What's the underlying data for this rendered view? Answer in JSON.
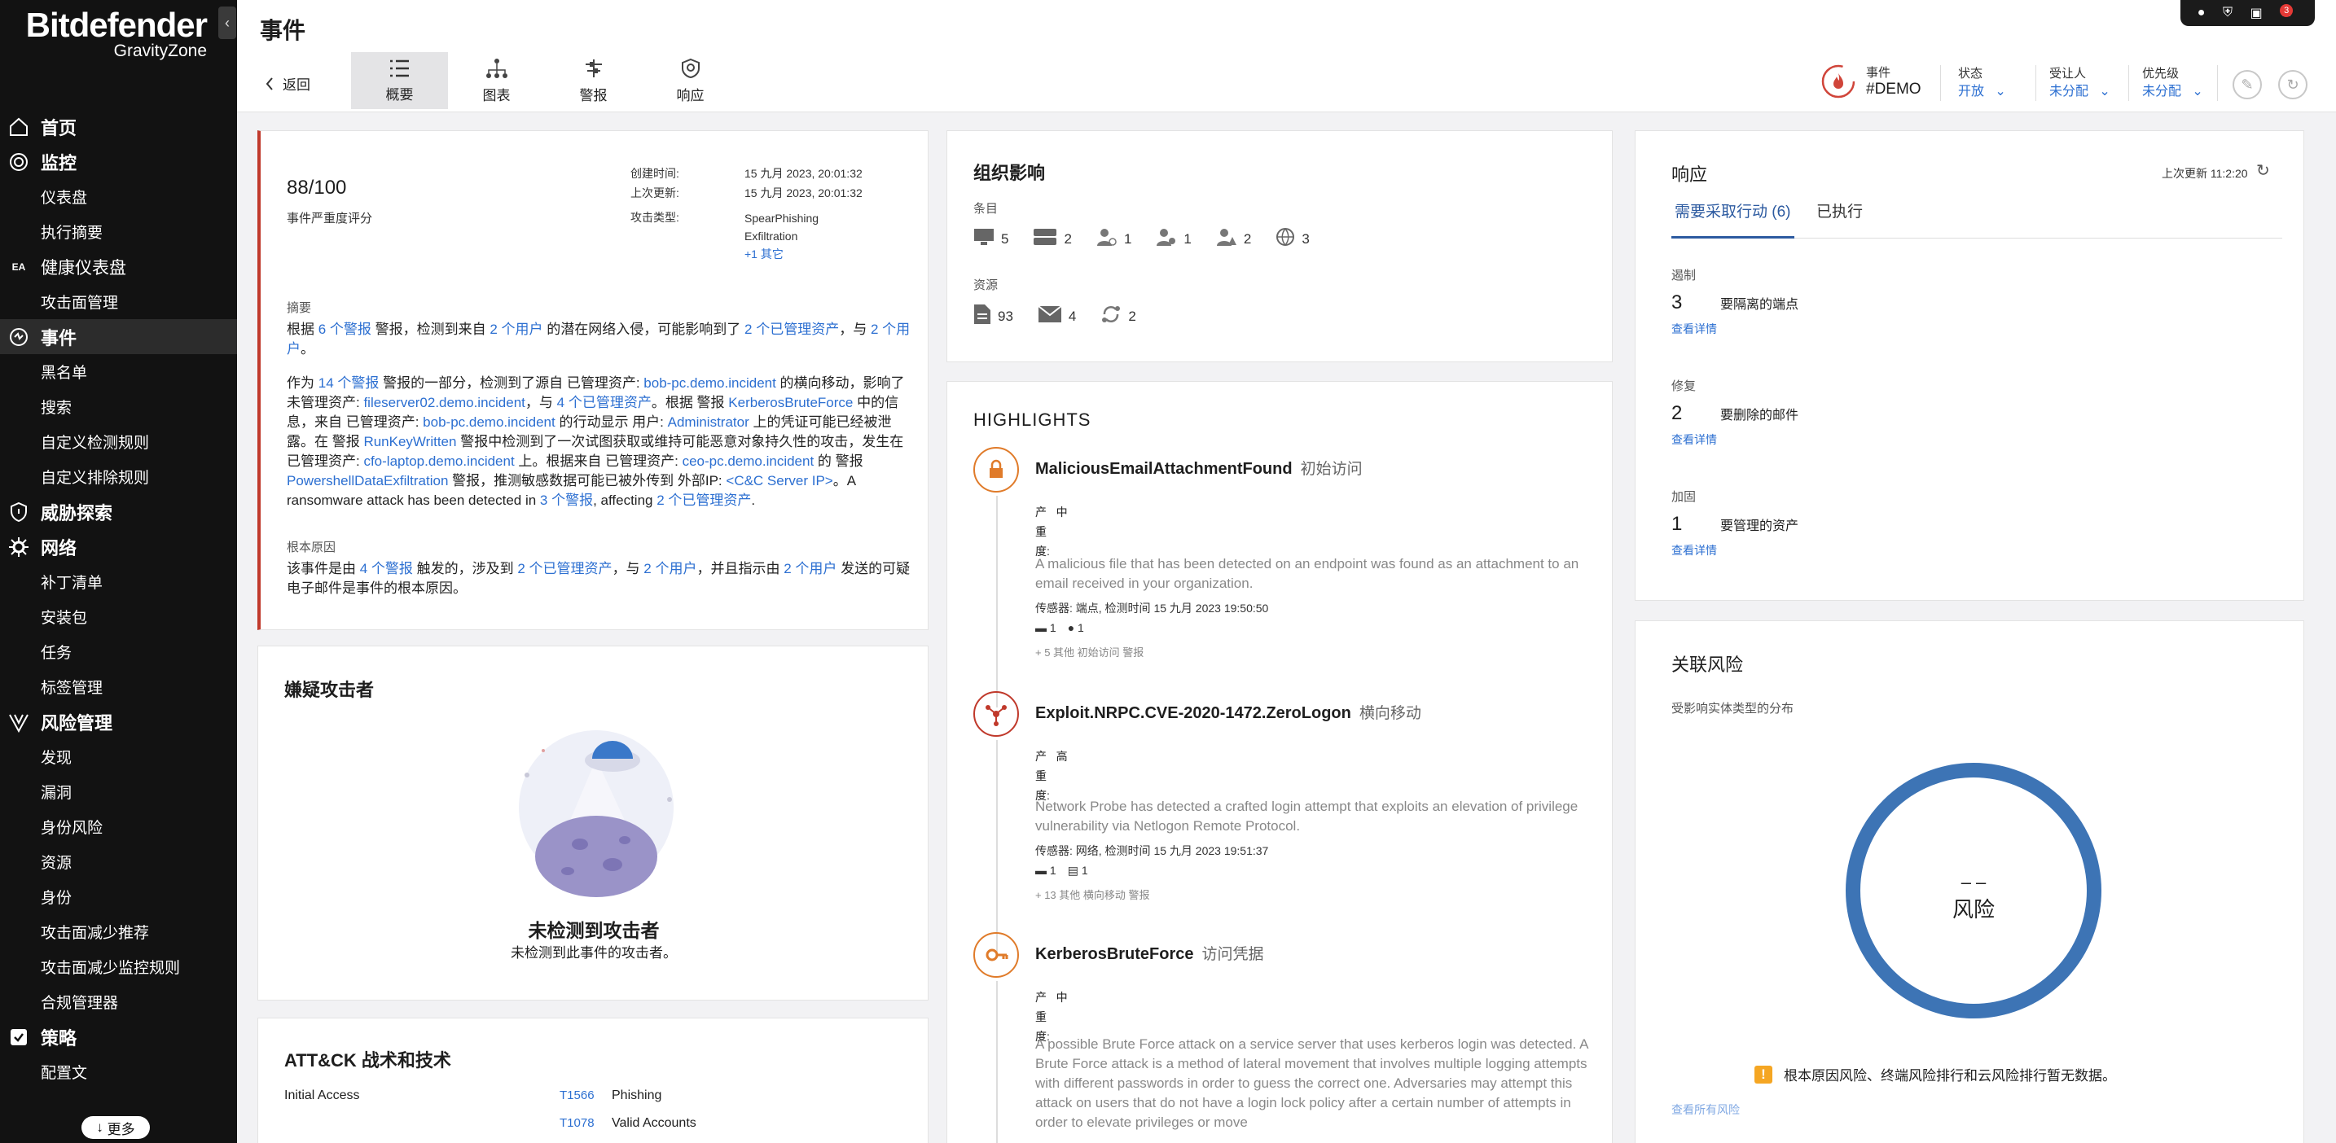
{
  "sidebar": {
    "brand": "Bitdefender",
    "brand_sub": "GravityZone",
    "items": [
      {
        "label": "首页",
        "kind": "sec",
        "icon": "home-icon"
      },
      {
        "label": "监控",
        "kind": "sec",
        "icon": "monitor-icon"
      },
      {
        "label": "仪表盘",
        "kind": "sub"
      },
      {
        "label": "执行摘要",
        "kind": "sub"
      },
      {
        "label": "健康仪表盘",
        "kind": "ea",
        "badge": "EA"
      },
      {
        "label": "攻击面管理",
        "kind": "sub"
      },
      {
        "label": "事件",
        "kind": "sec",
        "icon": "incidents-icon",
        "active": true
      },
      {
        "label": "黑名单",
        "kind": "sub"
      },
      {
        "label": "搜索",
        "kind": "sub"
      },
      {
        "label": "自定义检测规则",
        "kind": "sub"
      },
      {
        "label": "自定义排除规则",
        "kind": "sub"
      },
      {
        "label": "威胁探索",
        "kind": "sec",
        "icon": "shield-icon"
      },
      {
        "label": "网络",
        "kind": "sec",
        "icon": "network-icon"
      },
      {
        "label": "补丁清单",
        "kind": "sub"
      },
      {
        "label": "安装包",
        "kind": "sub"
      },
      {
        "label": "任务",
        "kind": "sub"
      },
      {
        "label": "标签管理",
        "kind": "sub"
      },
      {
        "label": "风险管理",
        "kind": "sec",
        "icon": "risk-icon"
      },
      {
        "label": "发现",
        "kind": "sub"
      },
      {
        "label": "漏洞",
        "kind": "sub"
      },
      {
        "label": "身份风险",
        "kind": "sub"
      },
      {
        "label": "资源",
        "kind": "sub"
      },
      {
        "label": "身份",
        "kind": "sub"
      },
      {
        "label": "攻击面减少推荐",
        "kind": "sub"
      },
      {
        "label": "攻击面减少监控规则",
        "kind": "sub"
      },
      {
        "label": "合规管理器",
        "kind": "sub"
      },
      {
        "label": "策略",
        "kind": "sec",
        "icon": "policy-icon"
      },
      {
        "label": "配置文",
        "kind": "sub"
      }
    ],
    "more": "更多"
  },
  "header": {
    "title": "事件",
    "back": "返回",
    "tabs": [
      "概要",
      "图表",
      "警报",
      "响应"
    ],
    "incident_label": "事件",
    "incident_id": "#DEMO",
    "status_label": "状态",
    "status_value": "开放",
    "assignee_label": "受让人",
    "assignee_value": "未分配",
    "priority_label": "优先级",
    "priority_value": "未分配",
    "notif_count": "3"
  },
  "summary": {
    "score": "88/100",
    "score_label": "事件严重度评分",
    "created_label": "创建时间:",
    "created_value": "15 九月 2023, 20:01:32",
    "updated_label": "上次更新:",
    "updated_value": "15 九月 2023, 20:01:32",
    "attack_label": "攻击类型:",
    "attack_values": [
      "SpearPhishing",
      "Exfiltration"
    ],
    "attack_more": "+1 其它",
    "abstract_label": "摘要",
    "p1": [
      {
        "t": "根据 "
      },
      {
        "t": "6 个警报",
        "l": true
      },
      {
        "t": " 警报，检测到来自 "
      },
      {
        "t": "2 个用户",
        "l": true
      },
      {
        "t": " 的潜在网络入侵，可能影响到了 "
      },
      {
        "t": "2 个已管理资产",
        "l": true
      },
      {
        "t": "，与 "
      },
      {
        "t": "2 个用户",
        "l": true
      },
      {
        "t": "。"
      }
    ],
    "p2": [
      {
        "t": "作为 "
      },
      {
        "t": "14 个警报",
        "l": true
      },
      {
        "t": " 警报的一部分，检测到了源自 已管理资产: "
      },
      {
        "t": "bob-pc.demo.incident",
        "l": true
      },
      {
        "t": " 的横向移动，影响了 未管理资产: "
      },
      {
        "t": "fileserver02.demo.incident",
        "l": true
      },
      {
        "t": "，与 "
      },
      {
        "t": "4 个已管理资产",
        "l": true
      },
      {
        "t": "。根据 警报 "
      },
      {
        "t": "KerberosBruteForce",
        "l": true
      },
      {
        "t": " 中的信息，来自 已管理资产: "
      },
      {
        "t": "bob-pc.demo.incident",
        "l": true
      },
      {
        "t": " 的行动显示 用户: "
      },
      {
        "t": "Administrator",
        "l": true
      },
      {
        "t": " 上的凭证可能已经被泄露。在 警报 "
      },
      {
        "t": "RunKeyWritten",
        "l": true
      },
      {
        "t": " 警报中检测到了一次试图获取或维持可能恶意对象持久性的攻击，发生在 已管理资产: "
      },
      {
        "t": "cfo-laptop.demo.incident",
        "l": true
      },
      {
        "t": " 上。根据来自 已管理资产: "
      },
      {
        "t": "ceo-pc.demo.incident",
        "l": true
      },
      {
        "t": " 的 警报 "
      },
      {
        "t": "PowershellDataExfiltration",
        "l": true
      },
      {
        "t": " 警报，推测敏感数据可能已被外传到 外部IP: "
      },
      {
        "t": "<C&C Server IP>",
        "l": true
      },
      {
        "t": "。A ransomware attack has been detected in "
      },
      {
        "t": "3 个警报",
        "l": true
      },
      {
        "t": ", affecting "
      },
      {
        "t": "2 个已管理资产",
        "l": true
      },
      {
        "t": "."
      }
    ],
    "root_label": "根本原因",
    "p3": [
      {
        "t": "该事件是由 "
      },
      {
        "t": "4 个警报",
        "l": true
      },
      {
        "t": " 触发的，涉及到 "
      },
      {
        "t": "2 个已管理资产",
        "l": true
      },
      {
        "t": "，与 "
      },
      {
        "t": "2 个用户",
        "l": true
      },
      {
        "t": "，并且指示由 "
      },
      {
        "t": "2 个用户",
        "l": true
      },
      {
        "t": " 发送的可疑电子邮件是事件的根本原因。"
      }
    ]
  },
  "attacker": {
    "title": "嫌疑攻击者",
    "none_title": "未检测到攻击者",
    "none_sub": "未检测到此事件的攻击者。"
  },
  "mitre": {
    "title": "ATT&CK 战术和技术",
    "rows": [
      {
        "tactic": "Initial Access",
        "id": "T1566",
        "name": "Phishing"
      },
      {
        "tactic": "",
        "id": "T1078",
        "name": "Valid Accounts"
      }
    ]
  },
  "impact": {
    "title": "组织影响",
    "items_label": "条目",
    "items": [
      {
        "icon": "desktop-icon",
        "value": "5"
      },
      {
        "icon": "server-icon",
        "value": "2"
      },
      {
        "icon": "user-group-icon",
        "value": "1"
      },
      {
        "icon": "user-settings-icon",
        "value": "1"
      },
      {
        "icon": "user-warning-icon",
        "value": "2"
      },
      {
        "icon": "globe-icon",
        "value": "3"
      }
    ],
    "resources_label": "资源",
    "resources": [
      {
        "icon": "file-icon",
        "value": "93"
      },
      {
        "icon": "mail-icon",
        "value": "4"
      },
      {
        "icon": "process-icon",
        "value": "2"
      }
    ]
  },
  "highlights": {
    "title": "HIGHLIGHTS",
    "items": [
      {
        "title": "MaliciousEmailAttachmentFound",
        "tag": "初始访问",
        "sev_label": [
          "产",
          "重",
          "度:"
        ],
        "sev": "中",
        "desc": "A malicious file that has been detected on an endpoint was found as an attachment to an email received in your organization.",
        "sensor": "传感器: 端点, 检测时间 15 九月 2023 19:50:50",
        "c1": "1",
        "c2": "1",
        "more": "+ 5 其他 初始访问 警报",
        "color": "orange"
      },
      {
        "title": "Exploit.NRPC.CVE-2020-1472.ZeroLogon",
        "tag": "横向移动",
        "sev_label": [
          "产",
          "重",
          "度:"
        ],
        "sev": "高",
        "desc": "Network Probe has detected a crafted login attempt that exploits an elevation of privilege vulnerability via Netlogon Remote Protocol.",
        "sensor": "传感器: 网络, 检测时间 15 九月 2023 19:51:37",
        "c1": "1",
        "c2": "1",
        "more": "+ 13 其他 横向移动 警报",
        "color": "red"
      },
      {
        "title": "KerberosBruteForce",
        "tag": "访问凭据",
        "sev_label": [
          "产",
          "重",
          "度:"
        ],
        "sev": "中",
        "desc": "A possible Brute Force attack on a service server that uses kerberos login was detected. A Brute Force attack is a method of lateral movement that involves multiple logging attempts with different passwords in order to guess the correct one. Adversaries may attempt this attack on users that do not have a login lock policy after a certain number of attempts in order to elevate privileges or move",
        "color": "orange"
      }
    ]
  },
  "response": {
    "title": "响应",
    "last_update": "上次更新 11:2:20",
    "tab_todo": "需要采取行动 (6)",
    "tab_done": "已执行",
    "groups": [
      {
        "label": "遏制",
        "num": "3",
        "text": "要隔离的端点",
        "link": "查看详情"
      },
      {
        "label": "修复",
        "num": "2",
        "text": "要删除的邮件",
        "link": "查看详情"
      },
      {
        "label": "加固",
        "num": "1",
        "text": "要管理的资产",
        "link": "查看详情"
      }
    ]
  },
  "risk": {
    "title": "关联风险",
    "subtitle": "受影响实体类型的分布",
    "center_dash": "– –",
    "center_label": "风险",
    "warning": "根本原因风险、终端风险排行和云风险排行暂无数据。",
    "view_all": "查看所有风险",
    "ring_color": "#3d74b5"
  }
}
